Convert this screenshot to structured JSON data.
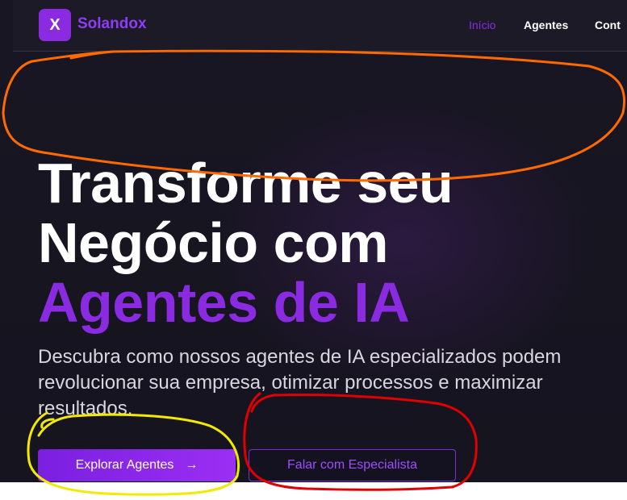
{
  "brand": {
    "logo_letter": "X",
    "name": "Solandox"
  },
  "nav": {
    "items": [
      {
        "label": "Início",
        "active": true
      },
      {
        "label": "Agentes",
        "active": false
      },
      {
        "label": "Cont",
        "active": false
      }
    ]
  },
  "hero": {
    "title_line1": "Transforme seu",
    "title_line2": "Negócio com",
    "title_accent": "Agentes de IA",
    "subtitle": "Descubra como nossos agentes de IA especializados podem revolucionar sua empresa, otimizar processos e maximizar resultados."
  },
  "buttons": {
    "primary_label": "Explorar Agentes",
    "primary_icon": "arrow-right-icon",
    "primary_arrow": "→",
    "secondary_label": "Falar com Especialista"
  },
  "colors": {
    "accent": "#8a2be2",
    "background": "#181622",
    "annotation_orange": "#ff6a00",
    "annotation_yellow": "#f2ea00",
    "annotation_red": "#e00000"
  }
}
